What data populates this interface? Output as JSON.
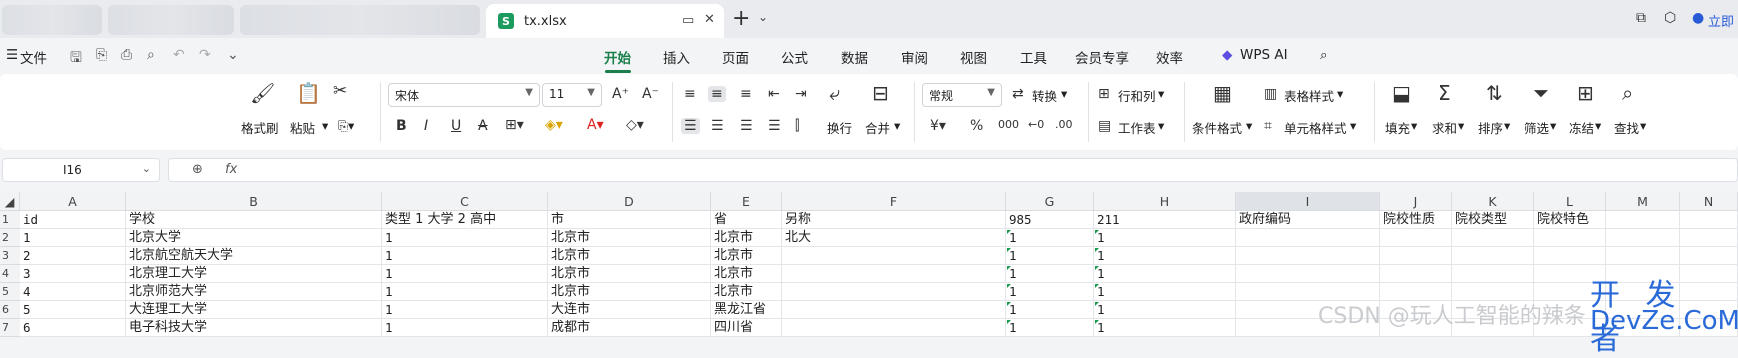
{
  "tabs": {
    "active_file": "tx.xlsx",
    "file_logo": "S",
    "login": "立即"
  },
  "menu": {
    "file": "文件",
    "items": [
      "开始",
      "插入",
      "页面",
      "公式",
      "数据",
      "审阅",
      "视图",
      "工具",
      "会员专享",
      "效率",
      "WPS AI"
    ],
    "active": "开始"
  },
  "ribbon": {
    "format_painter": "格式刷",
    "paste": "粘贴",
    "font": "宋体",
    "font_size": "11",
    "wrap": "换行",
    "merge": "合并",
    "number_format": "常规",
    "convert": "转换",
    "rows_cols": "行和列",
    "worksheet": "工作表",
    "cond_format": "条件格式",
    "table_style": "表格样式",
    "cell_style": "单元格样式",
    "fill": "填充",
    "sum": "求和",
    "sort": "排序",
    "filter": "筛选",
    "freeze": "冻结",
    "find": "查找"
  },
  "formula_bar": {
    "name_box": "I16",
    "fx": "fx"
  },
  "columns": [
    "A",
    "B",
    "C",
    "D",
    "E",
    "F",
    "G",
    "H",
    "I",
    "J",
    "K",
    "L",
    "M",
    "N"
  ],
  "row_numbers": [
    "1",
    "2",
    "3",
    "4",
    "5",
    "6",
    "7"
  ],
  "rows": [
    [
      "id",
      "学校",
      "类型 1 大学 2 高中",
      "市",
      "省",
      "另称",
      "985",
      "211",
      "政府编码",
      "院校性质",
      "院校类型",
      "院校特色",
      "",
      ""
    ],
    [
      "1",
      "北京大学",
      "1",
      "北京市",
      "北京市",
      "北大",
      "1",
      "1",
      "",
      "",
      "",
      "",
      "",
      ""
    ],
    [
      "2",
      "北京航空航天大学",
      "1",
      "北京市",
      "北京市",
      "",
      "1",
      "1",
      "",
      "",
      "",
      "",
      "",
      ""
    ],
    [
      "3",
      "北京理工大学",
      "1",
      "北京市",
      "北京市",
      "",
      "1",
      "1",
      "",
      "",
      "",
      "",
      "",
      ""
    ],
    [
      "4",
      "北京师范大学",
      "1",
      "北京市",
      "北京市",
      "",
      "1",
      "1",
      "",
      "",
      "",
      "",
      "",
      ""
    ],
    [
      "5",
      "大连理工大学",
      "1",
      "大连市",
      "黑龙江省",
      "",
      "1",
      "1",
      "",
      "",
      "",
      "",
      "",
      ""
    ],
    [
      "6",
      "电子科技大学",
      "1",
      "成都市",
      "四川省",
      "",
      "1",
      "1",
      "",
      "",
      "",
      "",
      "",
      ""
    ]
  ],
  "watermark": {
    "csdn": "CSDN @玩人工智能的辣条",
    "devze_cn": "开 发 者",
    "devze_en": "DevZe.CoM"
  }
}
